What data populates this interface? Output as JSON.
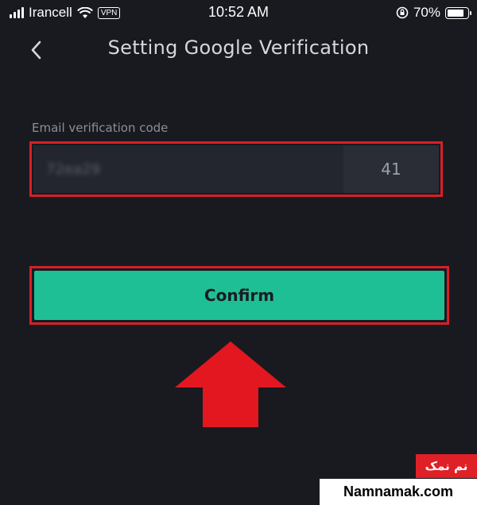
{
  "status_bar": {
    "carrier": "Irancell",
    "vpn": "VPN",
    "time": "10:52 AM",
    "battery_percent": "70%",
    "battery_level": 0.7,
    "icons": [
      "signal-icon",
      "wifi-icon",
      "rotation-lock-icon",
      "battery-icon"
    ]
  },
  "header": {
    "back_icon": "chevron-left-icon",
    "title": "Setting Google Verification"
  },
  "email_code": {
    "label": "Email verification code",
    "value": "72ea29",
    "countdown": "41"
  },
  "confirm": {
    "label": "Confirm"
  },
  "annotation": {
    "highlight_color": "#d71f27",
    "arrow": "arrow-up-icon"
  },
  "watermark": {
    "persian": "نم نمک",
    "site": "Namnamak.com"
  },
  "colors": {
    "background": "#181a20",
    "accent": "#1fbf96",
    "field": "#23262e"
  }
}
